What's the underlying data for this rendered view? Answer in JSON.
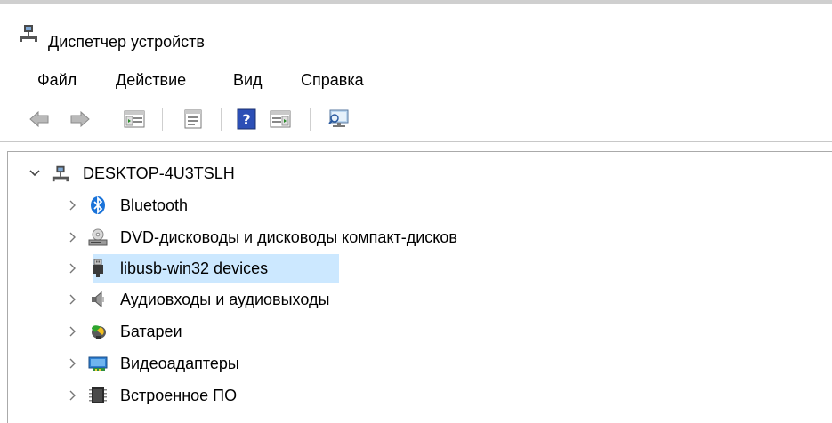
{
  "window": {
    "title": "Диспетчер устройств"
  },
  "menu": {
    "items": [
      "Файл",
      "Действие",
      "Вид",
      "Справка"
    ]
  },
  "toolbar": {
    "buttons": [
      "back",
      "forward",
      "show-hide-console-tree",
      "properties",
      "help",
      "action-pane",
      "scan-hardware-changes"
    ]
  },
  "tree": {
    "root": {
      "label": "DESKTOP-4U3TSLH",
      "expanded": true
    },
    "items": [
      {
        "label": "Bluetooth",
        "icon": "bluetooth-icon"
      },
      {
        "label": "DVD-дисководы и дисководы компакт-дисков",
        "icon": "dvd-drive-icon"
      },
      {
        "label": "libusb-win32 devices",
        "icon": "usb-plug-icon",
        "selected": true
      },
      {
        "label": "Аудиовходы и аудиовыходы",
        "icon": "speaker-icon"
      },
      {
        "label": "Батареи",
        "icon": "battery-icon"
      },
      {
        "label": "Видеоадаптеры",
        "icon": "display-adapter-icon"
      },
      {
        "label": "Встроенное ПО",
        "icon": "firmware-chip-icon"
      }
    ]
  }
}
